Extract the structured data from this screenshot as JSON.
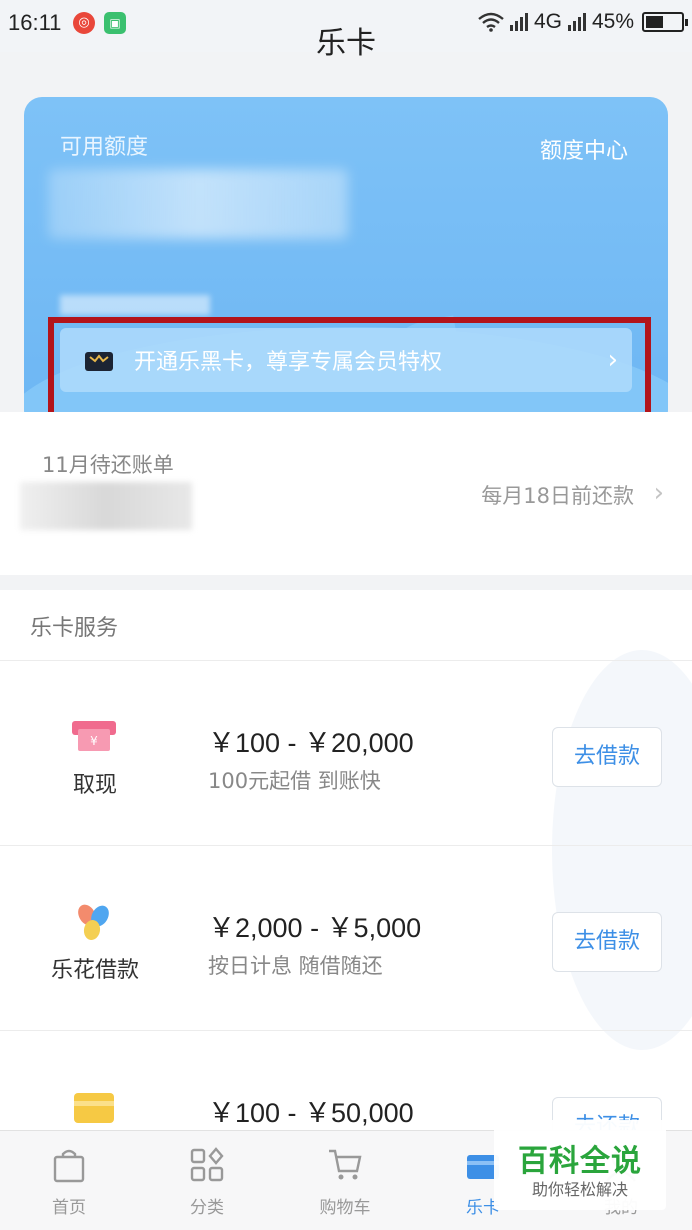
{
  "status_bar": {
    "time": "16:11",
    "network": "4G",
    "battery": "45%"
  },
  "header": {
    "title": "乐卡"
  },
  "card": {
    "available_label": "可用额度",
    "quota_center": "额度中心",
    "promo_text": "开通乐黑卡，尊享专属会员特权"
  },
  "bill": {
    "title": "11月待还账单",
    "due_text": "每月18日前还款"
  },
  "services": {
    "section_title": "乐卡服务",
    "items": [
      {
        "name": "取现",
        "range": "￥100 - ￥20,000",
        "desc": "100元起借  到账快",
        "button": "去借款"
      },
      {
        "name": "乐花借款",
        "range": "￥2,000 - ￥5,000",
        "desc": "按日计息  随借随还",
        "button": "去借款"
      },
      {
        "name": "",
        "range": "￥100 - ￥50,000",
        "desc": "",
        "button": "去还款"
      }
    ]
  },
  "tabbar": {
    "items": [
      {
        "label": "首页"
      },
      {
        "label": "分类"
      },
      {
        "label": "购物车"
      },
      {
        "label": "乐卡"
      },
      {
        "label": "我的"
      }
    ]
  },
  "watermark": {
    "main": "百科全说",
    "sub": "助你轻松解决"
  },
  "colors": {
    "accent": "#3d8fe6",
    "card": "#6db6f3",
    "highlight_border": "#b2141b"
  }
}
